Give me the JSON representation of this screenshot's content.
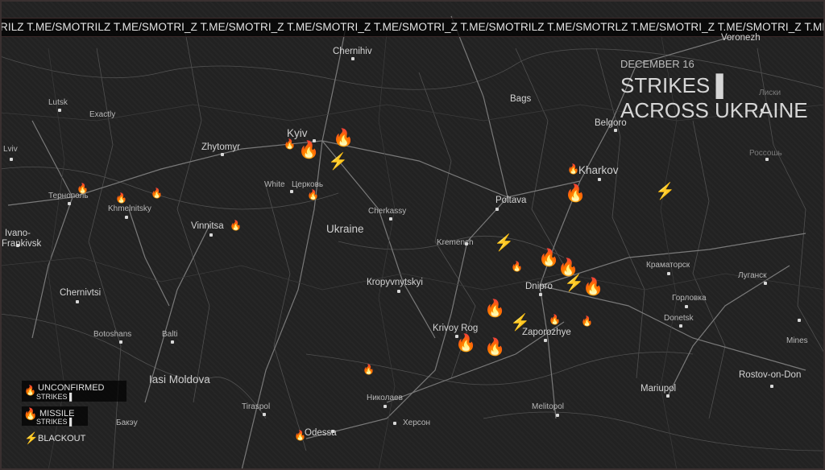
{
  "banner_text": "RILZ T.ME/SMOTRILZ T.ME/SMOTRI_Z T.ME/SMOTRI_Z T.ME/SMOTRI_Z T.ME/SMOTRI_Z T.ME/SMOTRILZ T.ME/SMOTRLZ T.ME/SMOTRI_Z T.ME/SMOTRI_Z T.ME/SMOTR",
  "title": {
    "date": "DECEMBER 16",
    "line1": "STRIKES ▌",
    "line2": "ACROSS UKRAINE"
  },
  "cities": {
    "voronezh": "Voronezh",
    "chernihiv": "Chernihiv",
    "lutsk": "Lutsk",
    "exactly": "Exactly",
    "kyiv": "Kyiv",
    "bags": "Bags",
    "belgorod": "Belgoro",
    "zhytomyr": "Zhytomyr",
    "lviv": "Lviv",
    "kharkov": "Kharkov",
    "ternopil": "Тернополь",
    "khmelnitsky": "Khmelnitsky",
    "white_church": "White",
    "tserkva": "Церковь",
    "poltava": "Poltava",
    "cherkassy": "Cherkassy",
    "vinnitsa": "Vinnitsa",
    "ivano1": "Ivano-",
    "ivano2": "Frankivsk",
    "ukraine": "Ukraine",
    "kremenchug": "Kremench",
    "kramatorsk": "Краматорск",
    "lugansk": "Луганск",
    "kropyvnytskyi": "Кropyvnytskyi",
    "dnipro": "Dnipro",
    "chernivtsi": "Chernivtsi",
    "gorlovka": "Горловка",
    "krivoy_rog": "Krivoy Rog",
    "zaporozhye": "Zaporozhye",
    "donetsk": "Donetsk",
    "botoshans": "Botoshans",
    "balti": "Balti",
    "mines": "Mines",
    "iasi": "Iasi Moldova",
    "rostov": "Rostov-on-Don",
    "mariupol": "Mariupol",
    "mykolaiv": "Николаев",
    "tiraspol": "Tiraspol",
    "melitopol": "Melitopol",
    "herson": "Херсон",
    "bakau": "Бакэу",
    "odessa": "Odessa",
    "lisk": "Лиски",
    "rossosh": "Россошь"
  },
  "legend": {
    "unconfirmed_label": "UNCONFIRMED",
    "unconfirmed_sub": "STRIKES ▌",
    "missile_label": "MISSILE",
    "missile_sub": "STRIKES ▌",
    "blackout_label": "BLACKOUT"
  },
  "icons": {
    "missile_strike": "🔥",
    "unconfirmed_strike": "🔥",
    "blackout": "⚡"
  },
  "colors": {
    "background": "#222222",
    "road": "#7a7a7a",
    "border": "#5a5a5a",
    "text": "#d6d6d6",
    "bolt": "#f2c200"
  }
}
